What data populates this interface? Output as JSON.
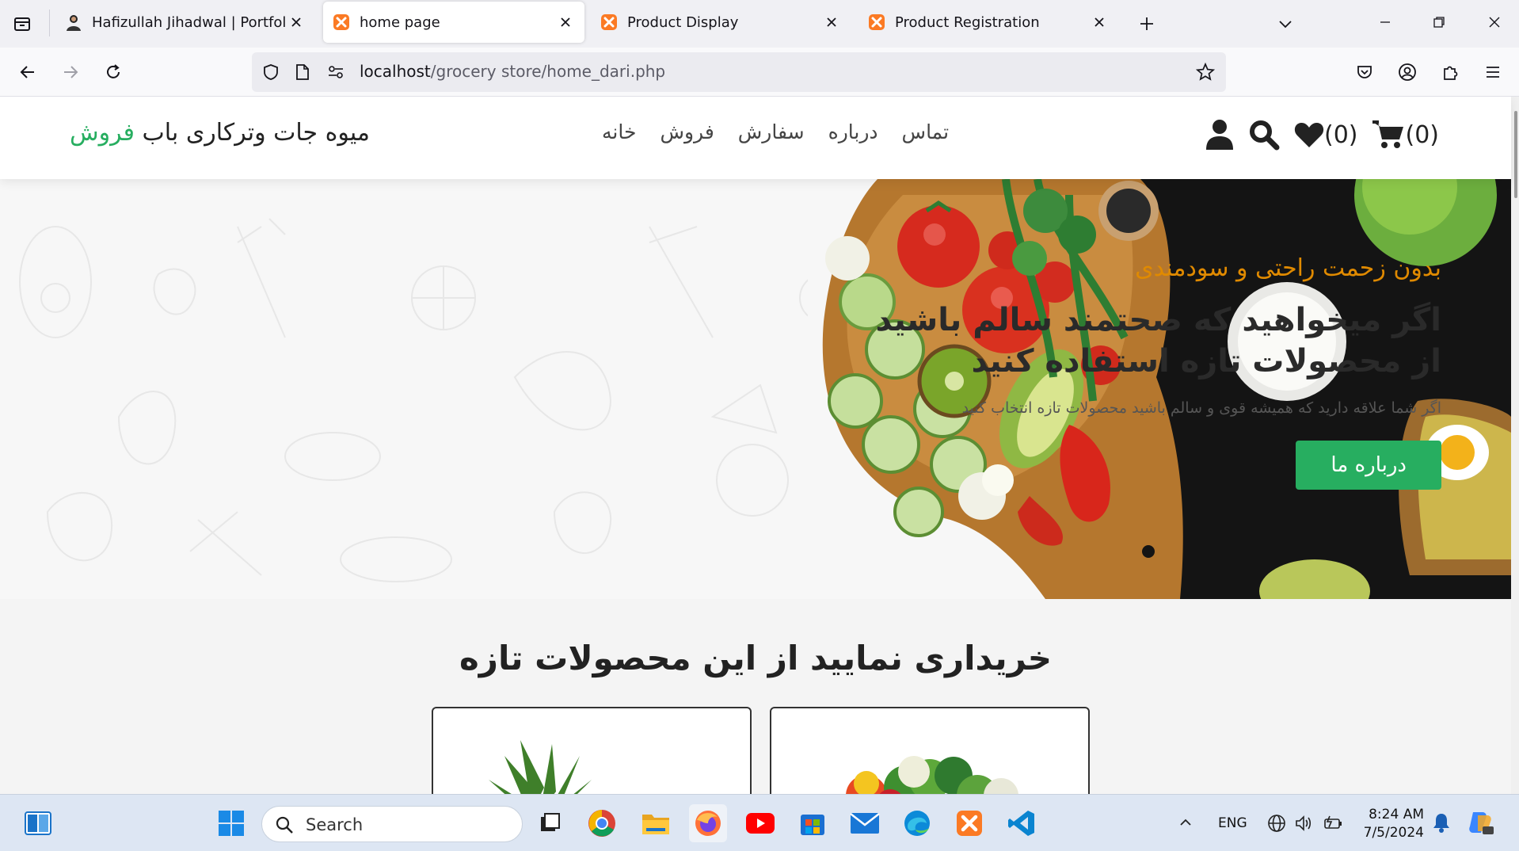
{
  "browser": {
    "tabs": [
      {
        "title": "Hafizullah Jihadwal | Portfolio",
        "active": false,
        "favicon": "user-avatar"
      },
      {
        "title": "home page",
        "active": true,
        "favicon": "xampp"
      },
      {
        "title": "Product Display",
        "active": false,
        "favicon": "xampp"
      },
      {
        "title": "Product Registration",
        "active": false,
        "favicon": "xampp"
      }
    ],
    "url": {
      "host": "localhost",
      "path": "/grocery store/home_dari.php"
    }
  },
  "site": {
    "logo": {
      "text": "میوه جات وترکاری باب ",
      "accent": "فروش"
    },
    "nav": [
      "خانه",
      "فروش",
      "سفارش",
      "درباره",
      "تماس"
    ],
    "wishlist_count": "(0)",
    "cart_count": "(0)",
    "hero": {
      "subtitle": "بدون زحمت راحتی و سودمندی",
      "title": "اگر میخواهید که صحتمند سالم باشید از محصولات تازه استفاده کنید",
      "description": "اگر شما علاقه دارید که همیشه قوی و سالم باشید محصولات تازه انتخاب کنید",
      "button": "درباره ما"
    },
    "section_title": "خریداری نمایید از این محصولات تازه"
  },
  "taskbar": {
    "search_placeholder": "Search",
    "language": "ENG",
    "time": "8:24 AM",
    "date": "7/5/2024"
  },
  "colors": {
    "accent": "#27ae60",
    "hero_subtitle": "#e08a00",
    "xampp": "#fb7a24"
  }
}
